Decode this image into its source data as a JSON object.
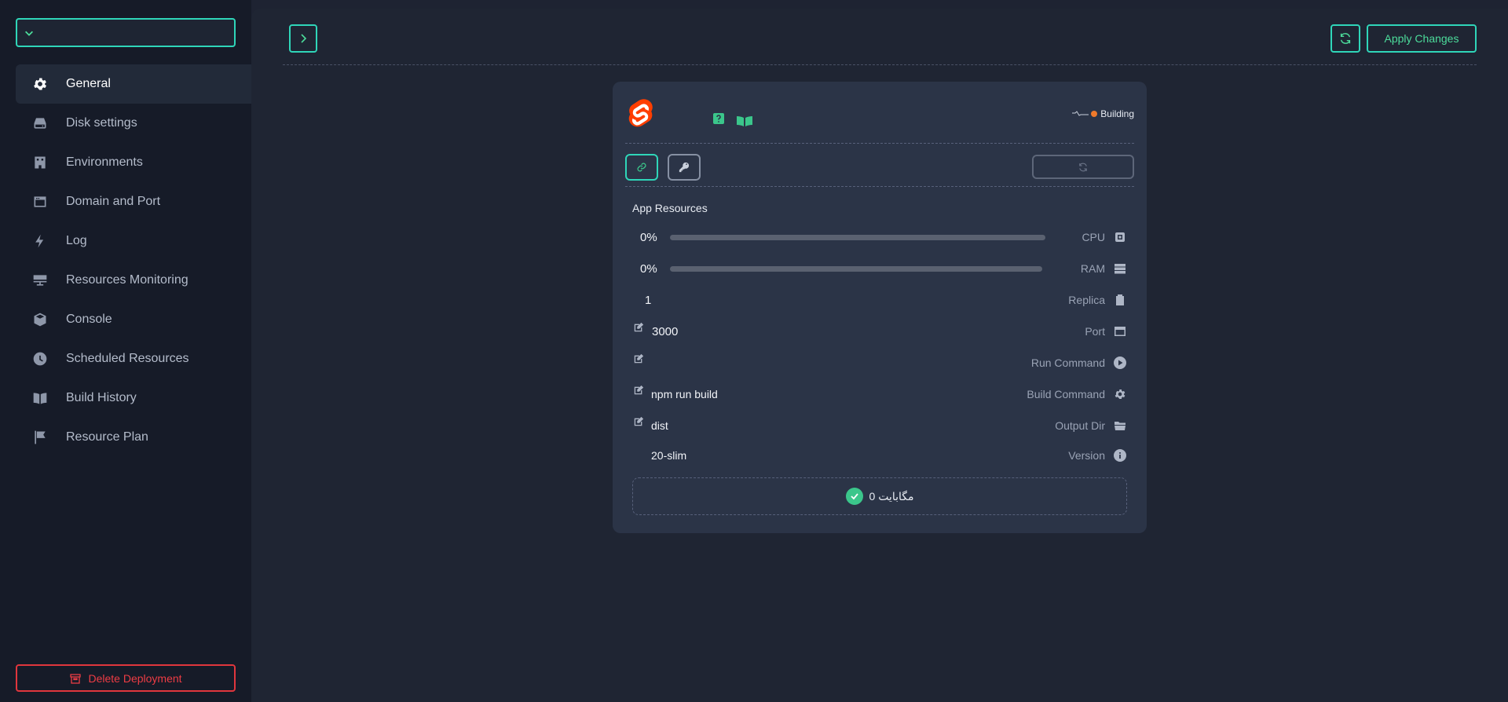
{
  "sidebar": {
    "app_selector_value": "",
    "items": [
      {
        "label": "General",
        "icon": "gear-icon",
        "active": true
      },
      {
        "label": "Disk settings",
        "icon": "hard-drive-icon",
        "active": false
      },
      {
        "label": "Environments",
        "icon": "building-icon",
        "active": false
      },
      {
        "label": "Domain and Port",
        "icon": "browser-window-icon",
        "active": false
      },
      {
        "label": "Log",
        "icon": "lightning-icon",
        "active": false
      },
      {
        "label": "Resources Monitoring",
        "icon": "server-icon",
        "active": false
      },
      {
        "label": "Console",
        "icon": "cube-icon",
        "active": false
      },
      {
        "label": "Scheduled Resources",
        "icon": "clock-icon",
        "active": false
      },
      {
        "label": "Build History",
        "icon": "book-icon",
        "active": false
      },
      {
        "label": "Resource Plan",
        "icon": "flag-icon",
        "active": false
      }
    ],
    "delete_label": "Delete Deployment"
  },
  "header": {
    "apply_label": "Apply Changes"
  },
  "card": {
    "status_text": "Building",
    "resources_title": "App Resources",
    "cpu": {
      "value": "0%",
      "label": "CPU",
      "fraction": 0
    },
    "ram": {
      "value": "0%",
      "label": "RAM",
      "fraction": 0
    },
    "replica": {
      "value": "1",
      "label": "Replica"
    },
    "port": {
      "value": "3000",
      "label": "Port"
    },
    "run_command": {
      "value": "",
      "label": "Run Command"
    },
    "build_command": {
      "value": "npm run build",
      "label": "Build Command"
    },
    "output_dir": {
      "value": "dist",
      "label": "Output Dir"
    },
    "version": {
      "value": "20-slim",
      "label": "Version"
    },
    "storage_text": "0 مگابایت"
  },
  "colors": {
    "accent": "#2fd6b9",
    "green": "#4cdc9b",
    "danger": "#ee3c44",
    "building": "#f07a2b",
    "svelte": "#ff3e00"
  }
}
